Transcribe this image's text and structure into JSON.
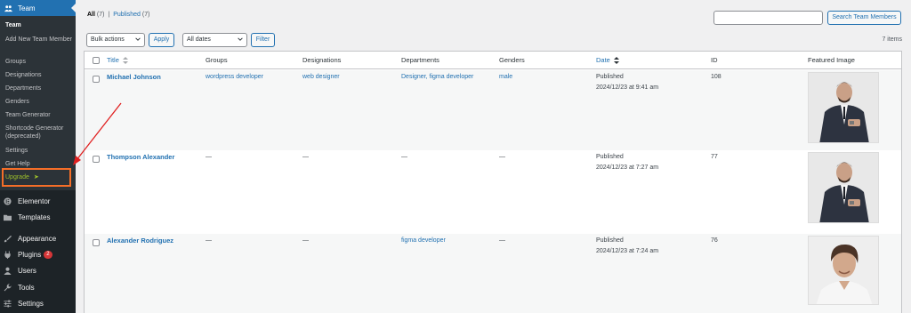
{
  "sidebar": {
    "menu_title": "Team",
    "submenu": [
      {
        "label": "Team",
        "current": true
      },
      {
        "label": "Add New Team Member"
      },
      {
        "label": "Groups"
      },
      {
        "label": "Designations"
      },
      {
        "label": "Departments"
      },
      {
        "label": "Genders"
      },
      {
        "label": "Team Generator"
      },
      {
        "label": "Shortcode Generator (deprecated)"
      },
      {
        "label": "Settings"
      },
      {
        "label": "Get Help"
      }
    ],
    "upgrade_label": "Upgrade",
    "upgrade_arrow": "➤",
    "menu": [
      {
        "label": "Elementor",
        "icon": "elementor-icon"
      },
      {
        "label": "Templates",
        "icon": "folder-icon"
      },
      {
        "label": "Appearance",
        "icon": "paintbrush-icon"
      },
      {
        "label": "Plugins",
        "icon": "plug-icon",
        "badge": "2"
      },
      {
        "label": "Users",
        "icon": "user-icon"
      },
      {
        "label": "Tools",
        "icon": "wrench-icon"
      },
      {
        "label": "Settings",
        "icon": "settings-icon"
      }
    ]
  },
  "views": {
    "all": "All",
    "all_count": "(7)",
    "separator": "|",
    "published": "Published",
    "published_count": "(7)"
  },
  "search": {
    "placeholder": "",
    "button_label": "Search Team Members"
  },
  "filters": {
    "bulk_actions": "Bulk actions",
    "apply": "Apply",
    "dates": "All dates",
    "filter": "Filter",
    "items_count": "7 items"
  },
  "table": {
    "columns": {
      "title": "Title",
      "groups": "Groups",
      "designations": "Designations",
      "departments": "Departments",
      "genders": "Genders",
      "date": "Date",
      "id": "ID",
      "featured_image": "Featured Image"
    },
    "rows": [
      {
        "title": "Michael Johnson",
        "groups": "wordpress developer",
        "designations": "web designer",
        "departments": "Designer, figma developer",
        "genders": "male",
        "status": "Published",
        "date": "2024/12/23 at 9:41 am",
        "id": "108"
      },
      {
        "title": "Thompson Alexander",
        "groups": "—",
        "designations": "—",
        "departments": "—",
        "genders": "—",
        "status": "Published",
        "date": "2024/12/23 at 7:27 am",
        "id": "77"
      },
      {
        "title": "Alexander Rodriguez",
        "groups": "—",
        "designations": "—",
        "departments": "figma developer",
        "genders": "—",
        "status": "Published",
        "date": "2024/12/23 at 7:24 am",
        "id": "76"
      }
    ]
  },
  "colors": {
    "admin_bar": "#1d2327",
    "accent": "#2271b1",
    "highlight_box": "#f56e28",
    "annotation_arrow": "#e02020",
    "upgrade": "#9ec02a"
  }
}
